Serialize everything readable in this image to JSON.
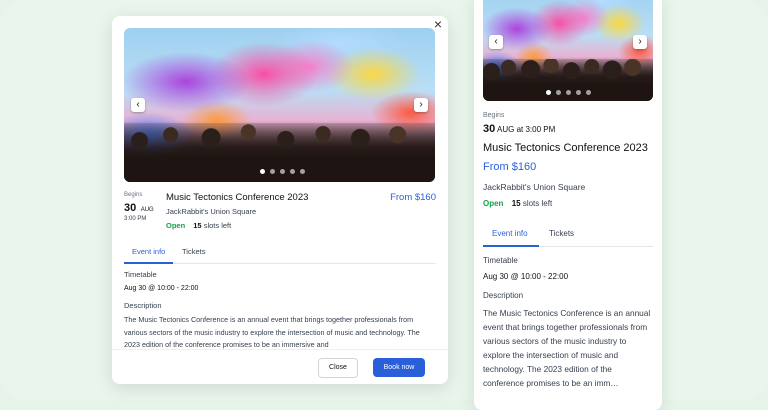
{
  "modal": {
    "close_icon": "×",
    "nav_prev": "‹",
    "nav_next": "›",
    "begins_label": "Begins",
    "day": "30",
    "month": "AUG",
    "time": "3:00 PM",
    "title": "Music Tectonics Conference 2023",
    "price": "From $160",
    "venue": "JackRabbit's Union Square",
    "status": "Open",
    "slots_count": "15",
    "slots_label": "slots left",
    "tabs": [
      {
        "label": "Event info",
        "active": true
      },
      {
        "label": "Tickets",
        "active": false
      }
    ],
    "timetable_label": "Timetable",
    "timetable_value": "Aug 30 @ 10:00 - 22:00",
    "description_label": "Description",
    "description": "The Music Tectonics Conference is an annual event that brings together professionals from various sectors of the music industry to explore the intersection of music and technology. The 2023 edition of the conference promises to be an immersive and",
    "close_button": "Close",
    "book_button": "Book now",
    "carousel_dots": 5,
    "carousel_active": 0
  },
  "side": {
    "nav_prev": "‹",
    "nav_next": "›",
    "begins_label": "Begins",
    "day": "30",
    "date_rest": "AUG at 3:00 PM",
    "title": "Music Tectonics Conference 2023",
    "price": "From $160",
    "venue": "JackRabbit's Union Square",
    "status": "Open",
    "slots_count": "15",
    "slots_label": "slots left",
    "tabs": [
      {
        "label": "Event info",
        "active": true
      },
      {
        "label": "Tickets",
        "active": false
      }
    ],
    "timetable_label": "Timetable",
    "timetable_value": "Aug 30 @ 10:00 - 22:00",
    "description_label": "Description",
    "description": "The Music Tectonics Conference is an annual event that brings together professionals from various sectors of the music industry to explore the intersection of music and technology. The 2023 edition of the conference promises to be an imm…",
    "carousel_dots": 5,
    "carousel_active": 0
  },
  "colors": {
    "accent": "#2b5fd9",
    "open": "#16a34a",
    "background": "#e6f4ea"
  }
}
